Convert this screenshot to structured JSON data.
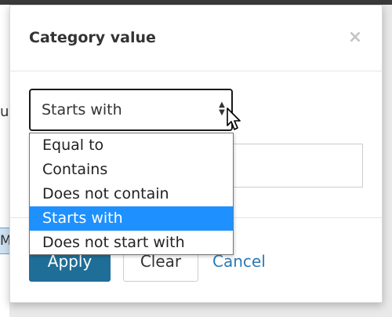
{
  "background": {
    "partial_label": "ue",
    "partial_box_label": "M"
  },
  "dialog": {
    "title": "Category value",
    "close_symbol": "×",
    "select_value": "Starts with",
    "select_arrows": "▲▼",
    "value_input": "",
    "apply_label": "Apply",
    "clear_label": "Clear",
    "cancel_label": "Cancel"
  },
  "dropdown": {
    "options": [
      "Equal to",
      "Contains",
      "Does not contain",
      "Starts with",
      "Does not start with"
    ],
    "selected": "Starts with"
  },
  "colors": {
    "accent": "#1f6e97",
    "highlight": "#1e90ff",
    "link": "#2a7ab8"
  },
  "icons": {
    "close": "close-icon",
    "select_arrows": "select-arrows-icon",
    "cursor": "mouse-cursor-icon"
  }
}
